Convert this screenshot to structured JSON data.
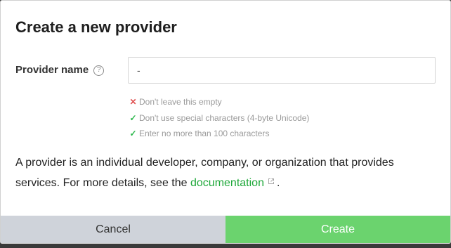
{
  "dialog": {
    "title": "Create a new provider",
    "field": {
      "label": "Provider name",
      "help_icon": "question-circle-icon",
      "value": "-"
    },
    "rules": [
      {
        "status": "fail",
        "icon": "x-icon",
        "text": "Don't leave this empty"
      },
      {
        "status": "pass",
        "icon": "check-icon",
        "text": "Don't use special characters (4-byte Unicode)"
      },
      {
        "status": "pass",
        "icon": "check-icon",
        "text": "Enter no more than 100 characters"
      }
    ],
    "description": {
      "text_before": "A provider is an individual developer, company, or organization that provides services. For more details, see the",
      "link_text": "documentation",
      "link_icon": "external-link-icon",
      "text_after": "."
    },
    "buttons": {
      "cancel": "Cancel",
      "create": "Create"
    },
    "colors": {
      "accent_green": "#1fa83a",
      "create_button": "#6bd36e",
      "cancel_button": "#cfd3da",
      "fail": "#e05252",
      "pass": "#2db84d"
    }
  }
}
